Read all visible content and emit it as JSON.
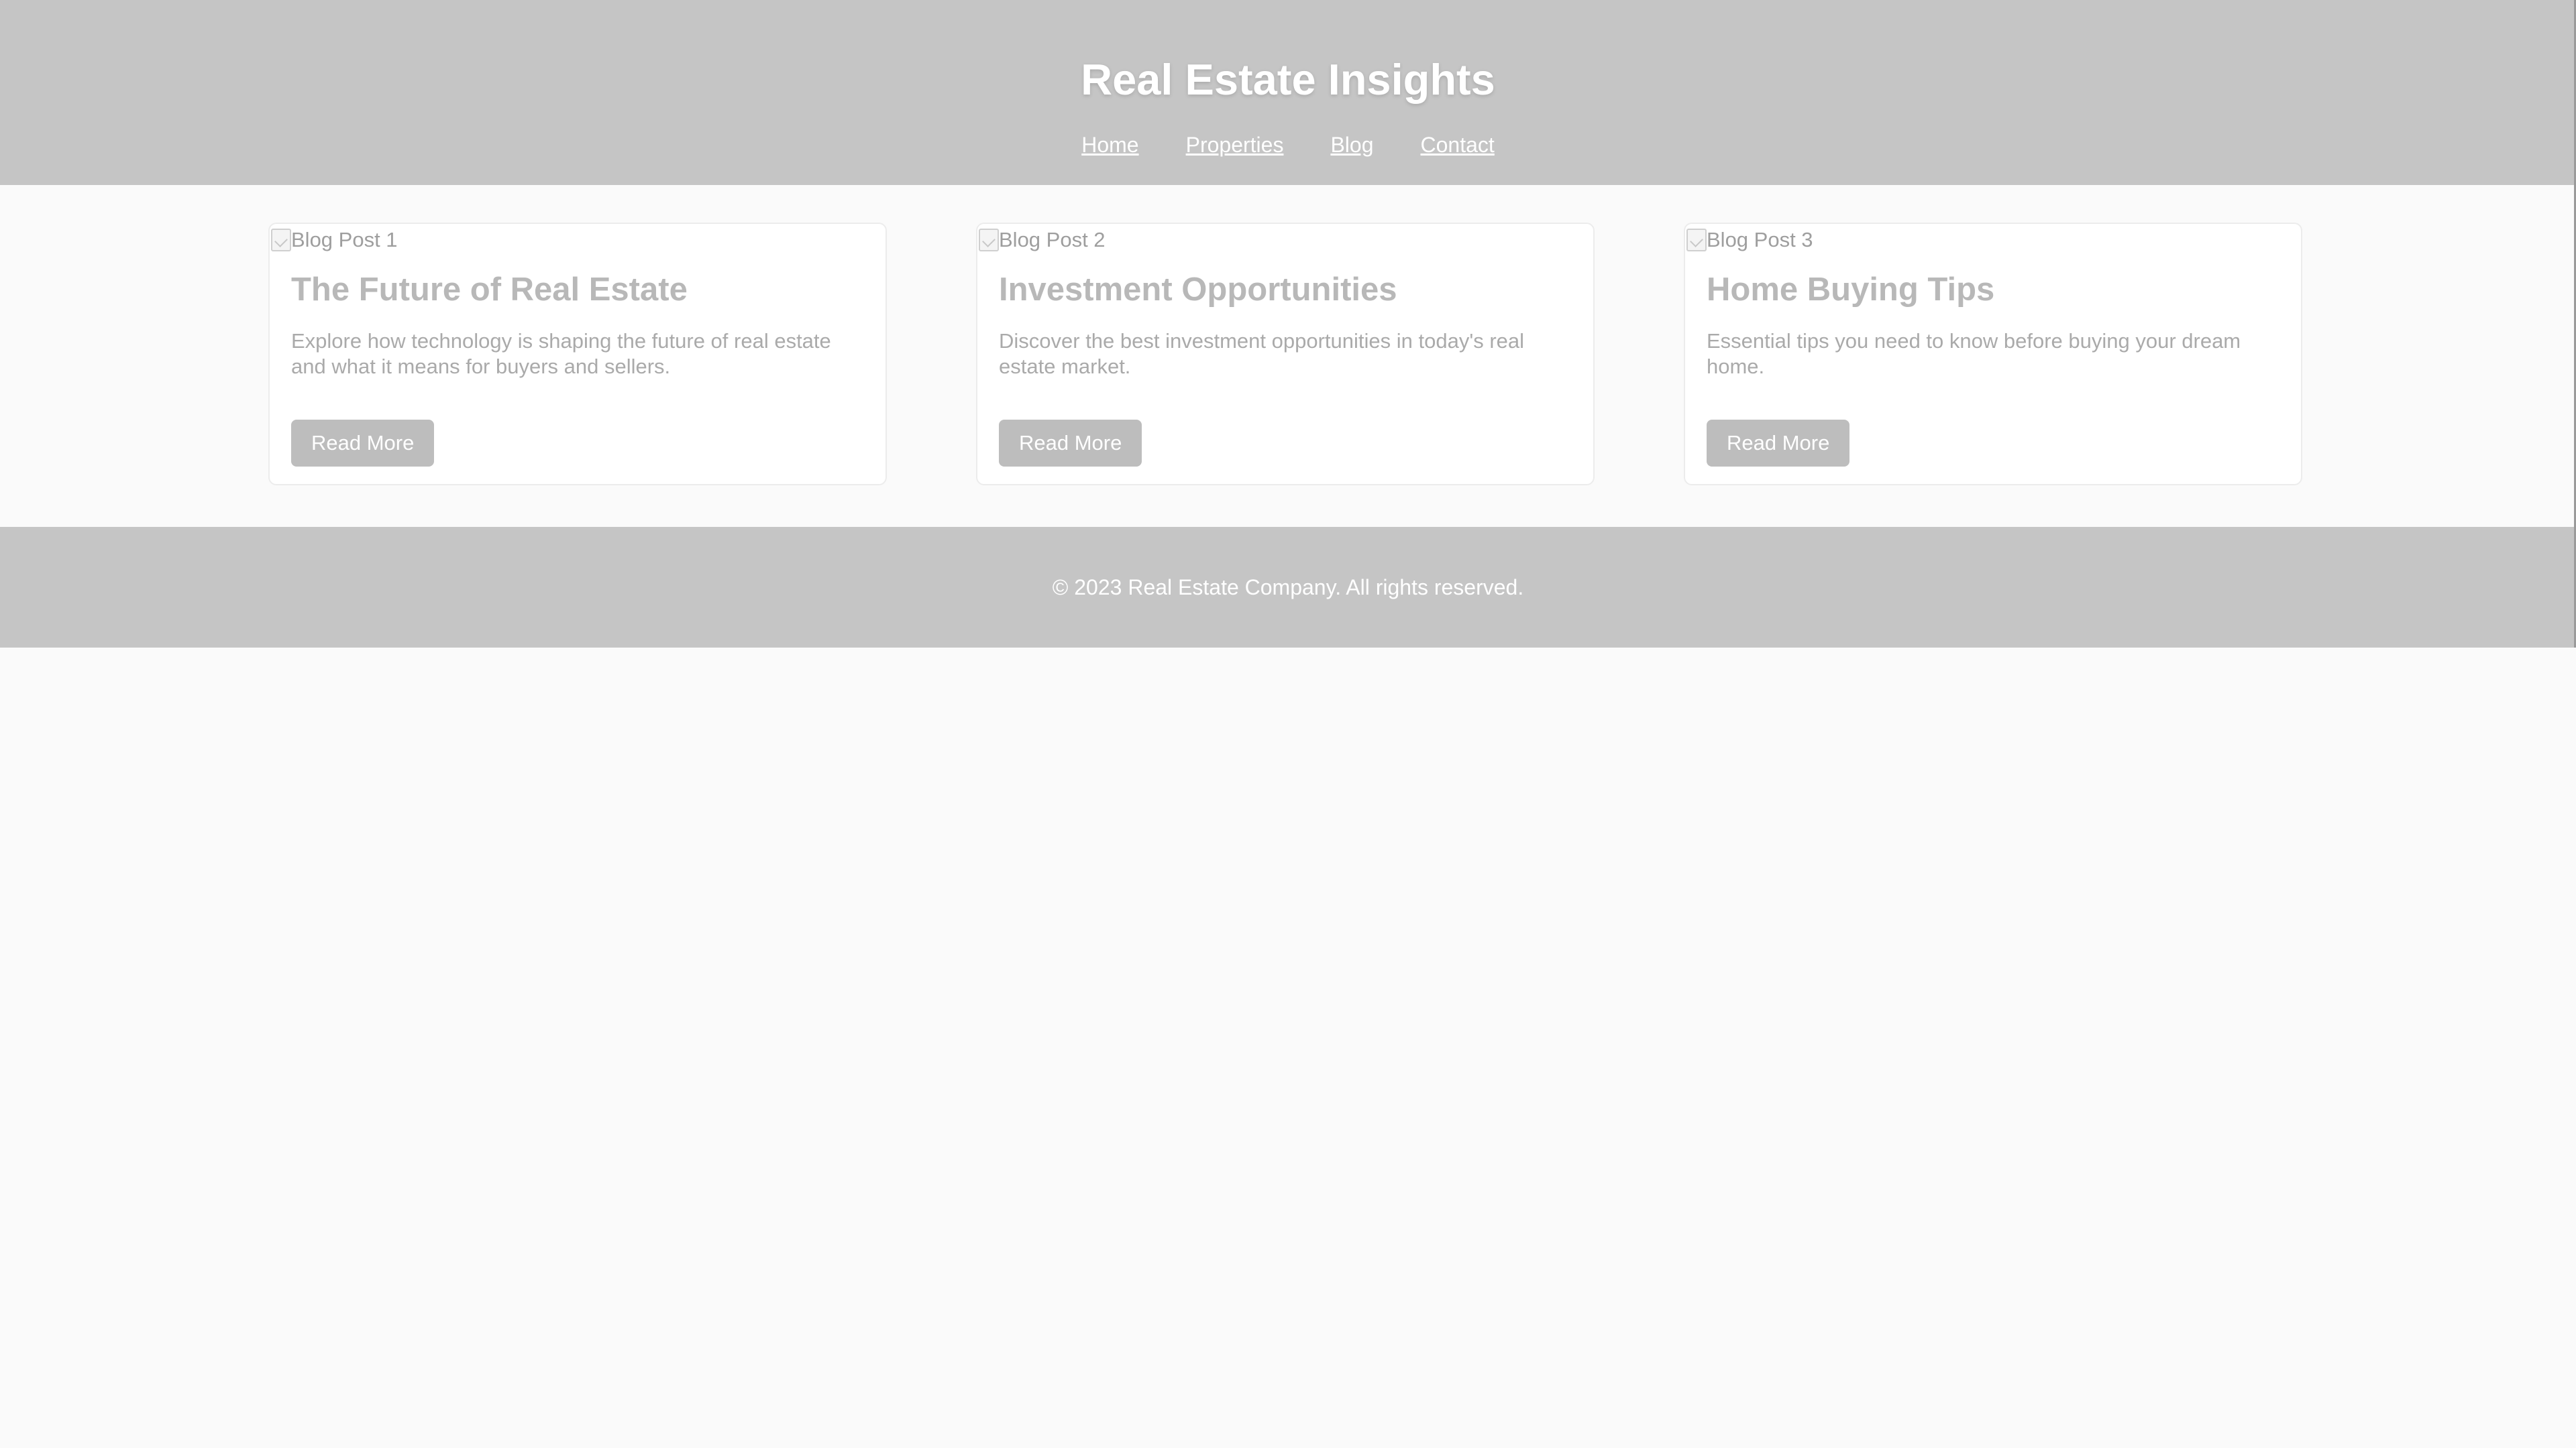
{
  "header": {
    "title": "Real Estate Insights",
    "nav": [
      {
        "label": "Home"
      },
      {
        "label": "Properties"
      },
      {
        "label": "Blog"
      },
      {
        "label": "Contact"
      }
    ]
  },
  "posts": [
    {
      "image_alt": "Blog Post 1",
      "title": "The Future of Real Estate",
      "description": "Explore how technology is shaping the future of real estate and what it means for buyers and sellers.",
      "button_label": "Read More"
    },
    {
      "image_alt": "Blog Post 2",
      "title": "Investment Opportunities",
      "description": "Discover the best investment opportunities in today's real estate market.",
      "button_label": "Read More"
    },
    {
      "image_alt": "Blog Post 3",
      "title": "Home Buying Tips",
      "description": "Essential tips you need to know before buying your dream home.",
      "button_label": "Read More"
    }
  ],
  "footer": {
    "text": "© 2023 Real Estate Company. All rights reserved."
  },
  "colors": {
    "header_bg": "#c5c5c5",
    "page_bg": "#fafafa",
    "button_bg": "#bdbdbd"
  },
  "icons": {
    "broken_image": "broken-image-icon"
  }
}
